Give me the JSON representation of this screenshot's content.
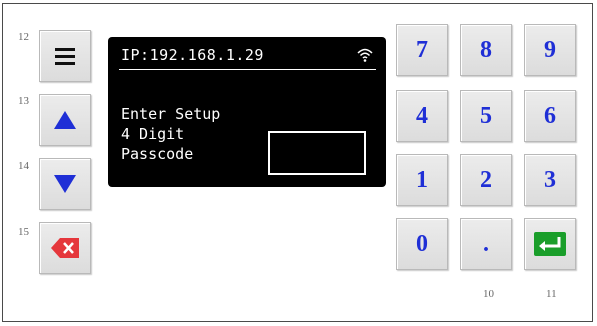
{
  "side_buttons": [
    {
      "label": "12",
      "icon": "menu-icon"
    },
    {
      "label": "13",
      "icon": "arrow-up-icon"
    },
    {
      "label": "14",
      "icon": "arrow-down-icon"
    },
    {
      "label": "15",
      "icon": "backspace-icon"
    }
  ],
  "display": {
    "ip": "IP:192.168.1.29",
    "message": "Enter Setup\n4 Digit\nPasscode",
    "passcode_value": ""
  },
  "keypad": {
    "k7": "7",
    "k8": "8",
    "k9": "9",
    "k4": "4",
    "k5": "5",
    "k6": "6",
    "k1": "1",
    "k2": "2",
    "k3": "3",
    "k0": "0",
    "kdot": "."
  },
  "bottom_labels": {
    "dot_key": "10",
    "enter_key": "11"
  },
  "colors": {
    "digit": "#1f2fd6",
    "arrow": "#1f2fd6",
    "backspace": "#e5373c",
    "enter": "#1a9e2a"
  }
}
